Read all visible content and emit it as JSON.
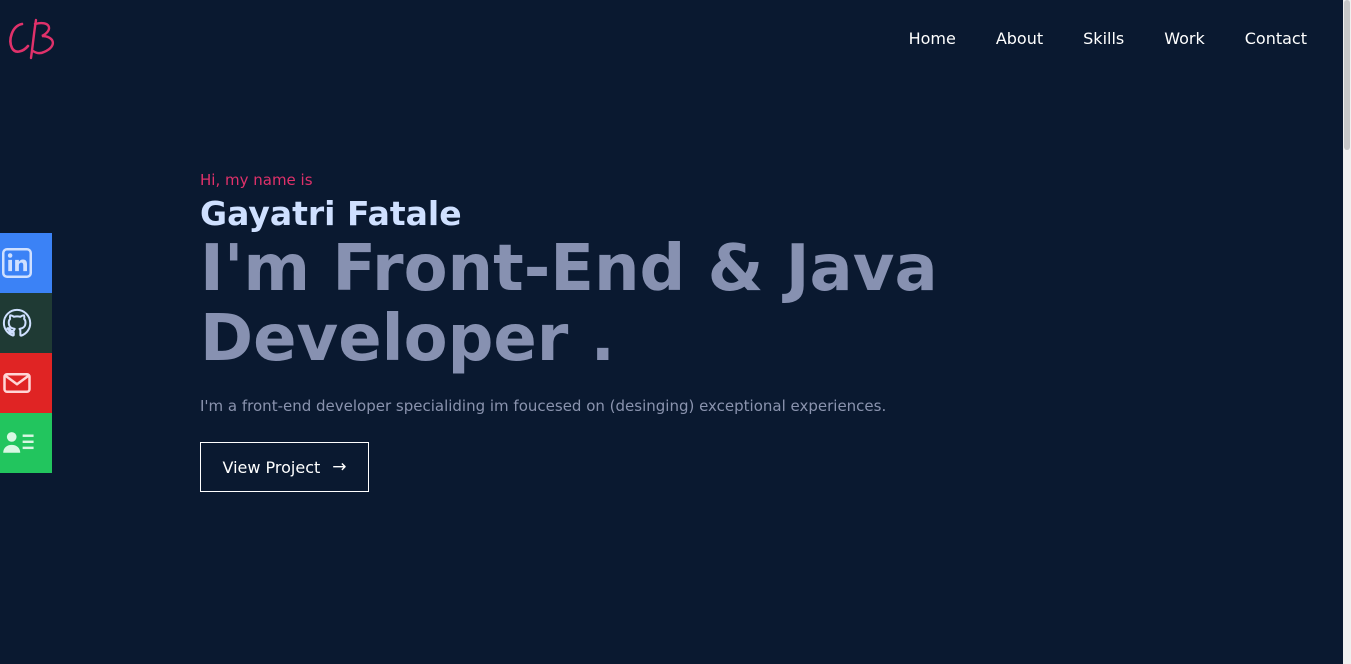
{
  "logo": {
    "text": "CB",
    "color": "#e0316a"
  },
  "nav": {
    "items": [
      {
        "label": "Home"
      },
      {
        "label": "About"
      },
      {
        "label": "Skills"
      },
      {
        "label": "Work"
      },
      {
        "label": "Contact"
      }
    ]
  },
  "social": {
    "items": [
      {
        "icon": "linkedin-icon",
        "color": "#3b82f6"
      },
      {
        "icon": "github-icon",
        "color": "#1f3a34"
      },
      {
        "icon": "mail-icon",
        "color": "#e02424"
      },
      {
        "icon": "contact-card-icon",
        "color": "#22c55e"
      }
    ]
  },
  "hero": {
    "greeting": "Hi, my name is",
    "name": "Gayatri Fatale",
    "headline": "I'm Front-End & Java Developer .",
    "description": "I'm a front-end developer specialiding im foucesed on (desinging) exceptional experiences.",
    "cta_label": "View Project",
    "cta_arrow": "→"
  },
  "colors": {
    "background": "#0a1930",
    "accent": "#e0316a",
    "name": "#cfe0ff",
    "headline": "#8791b1"
  }
}
